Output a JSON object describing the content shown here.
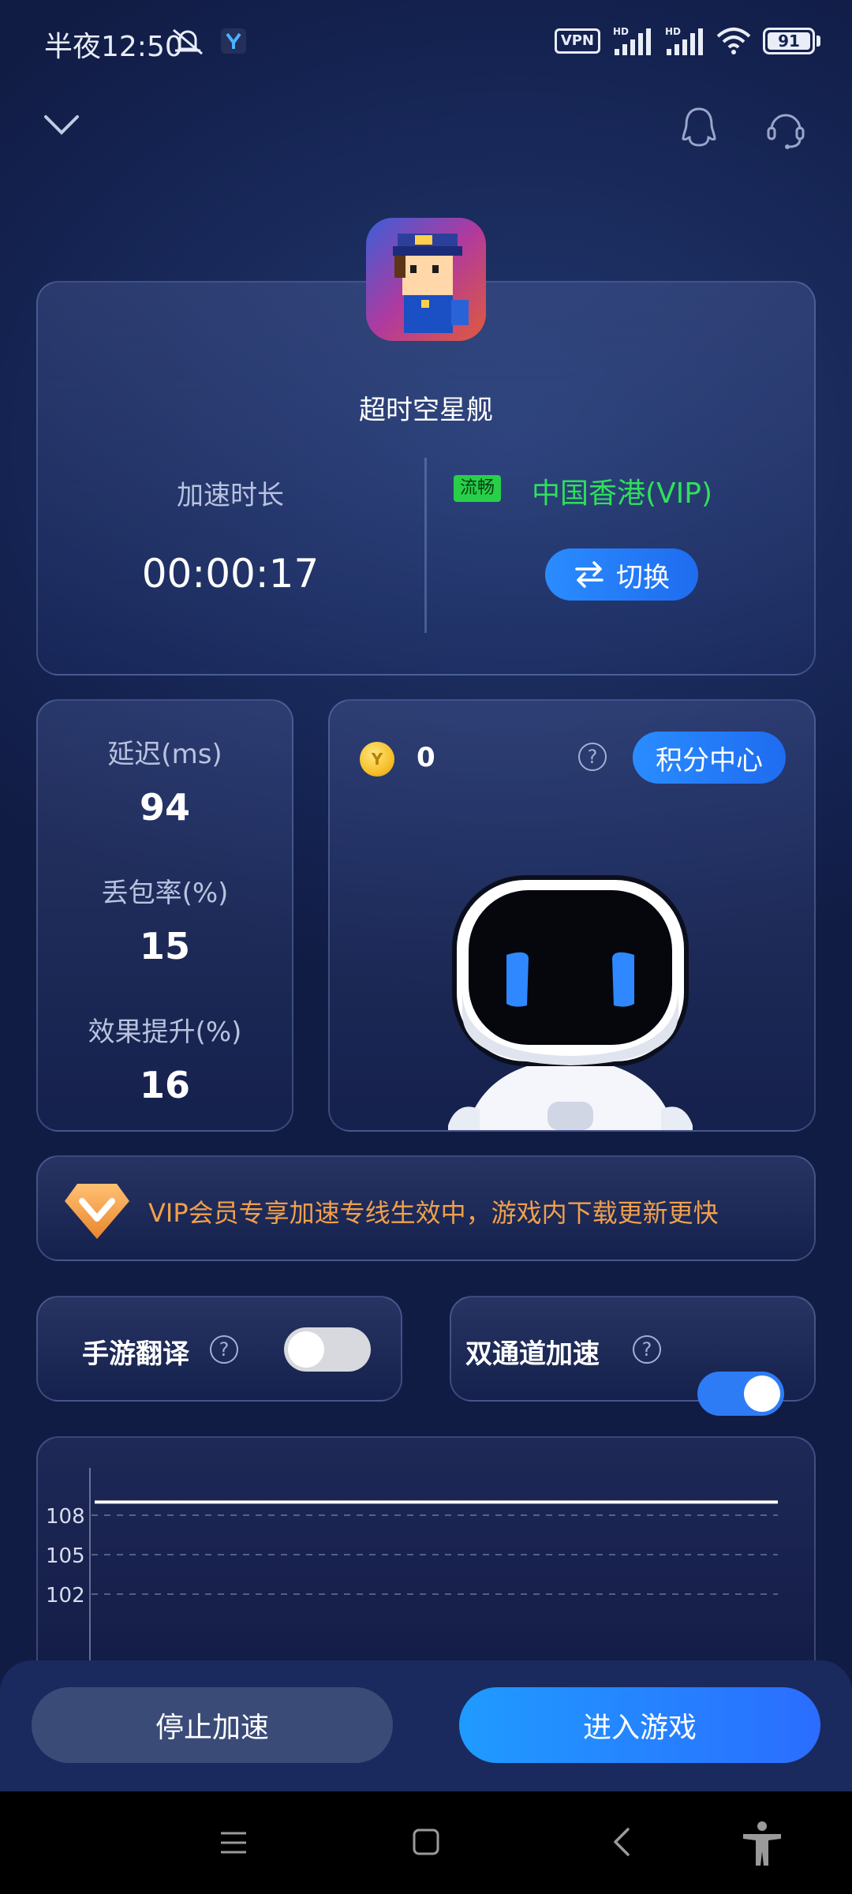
{
  "status_bar": {
    "time": "半夜12:50",
    "vpn": "VPN",
    "signal_label_1": "HD",
    "signal_label_2": "HD",
    "battery": "91"
  },
  "header": {
    "collapse_icon": "chevron-down-icon",
    "qq_icon": "penguin-icon",
    "support_icon": "headset-icon"
  },
  "game": {
    "name": "超时空星舰"
  },
  "acceleration": {
    "duration_label": "加速时长",
    "duration_value": "00:00:17",
    "line_quality": "流畅",
    "region": "中国香港(VIP)",
    "switch_label": "切换"
  },
  "stats": {
    "latency_label": "延迟(ms)",
    "latency_value": "94",
    "loss_label": "丢包率(%)",
    "loss_value": "15",
    "boost_label": "效果提升(%)",
    "boost_value": "16"
  },
  "points": {
    "count": "0",
    "help": "?",
    "center_button": "积分中心"
  },
  "vip_banner": {
    "text": "VIP会员专享加速专线生效中，游戏内下载更新更快"
  },
  "toggles": {
    "translate_label": "手游翻译",
    "translate_on": false,
    "dual_label": "双通道加速",
    "dual_on": true,
    "help": "?"
  },
  "chart_data": {
    "type": "line",
    "y_ticks": [
      "108",
      "105",
      "102"
    ],
    "series": [
      {
        "values": [
          109,
          109,
          109,
          109,
          109
        ]
      }
    ],
    "grid": true
  },
  "actions": {
    "stop": "停止加速",
    "enter": "进入游戏"
  },
  "colors": {
    "accent_blue": "#2a8cff",
    "region_green": "#2fe05a",
    "vip_orange": "#f0a04b"
  }
}
